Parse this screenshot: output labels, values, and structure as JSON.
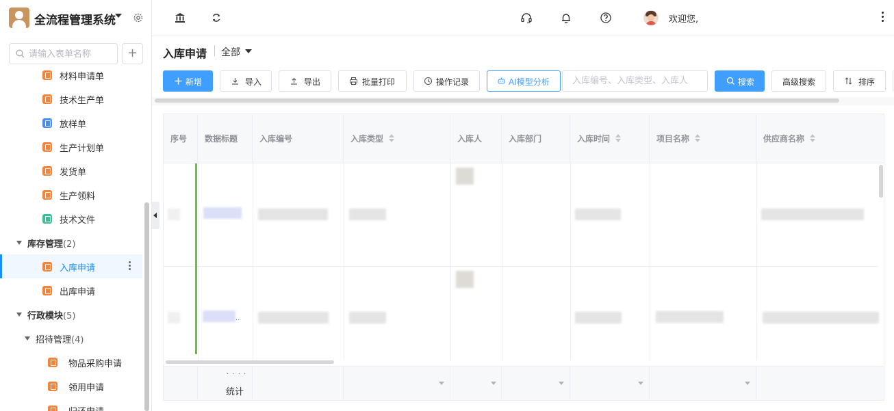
{
  "app": {
    "title": "全流程管理系统"
  },
  "sidebar": {
    "search_placeholder": "请输入表单名称",
    "items": [
      {
        "label": "材料申请单",
        "icon": "form-icon",
        "color": "#f5843a"
      },
      {
        "label": "技术生产单",
        "icon": "form-icon",
        "color": "#f5843a"
      },
      {
        "label": "放样单",
        "icon": "form-icon",
        "color": "#4a8ef5"
      },
      {
        "label": "生产计划单",
        "icon": "form-icon",
        "color": "#f5843a"
      },
      {
        "label": "发货单",
        "icon": "form-icon",
        "color": "#f5843a"
      },
      {
        "label": "生产领料",
        "icon": "form-icon",
        "color": "#f5843a"
      },
      {
        "label": "技术文件",
        "icon": "form-icon",
        "color": "#3dbf9c"
      }
    ],
    "group_inventory": {
      "label": "库存管理",
      "count": "(2)"
    },
    "inventory_items": [
      {
        "label": "入库申请",
        "active": true
      },
      {
        "label": "出库申请"
      }
    ],
    "group_admin": {
      "label": "行政模块",
      "count": "(5)"
    },
    "subgroup_reception": {
      "label": "招待管理",
      "count": "(4)"
    },
    "reception_items": [
      {
        "label": "物品采购申请"
      },
      {
        "label": "领用申请"
      },
      {
        "label": "归还申请"
      }
    ]
  },
  "header": {
    "welcome": "欢迎您,"
  },
  "page": {
    "title": "入库申请",
    "scope": "全部"
  },
  "toolbar": {
    "new_label": "新增",
    "import_label": "导入",
    "export_label": "导出",
    "batch_print_label": "批量打印",
    "log_label": "操作记录",
    "ai_label": "AI模型分析",
    "keyword_placeholder": "入库编号、入库类型、入库人",
    "search_label": "搜索",
    "advanced_label": "高级搜索",
    "sort_label": "排序"
  },
  "table": {
    "columns": [
      "序号",
      "数据标题",
      "入库编号",
      "入库类型",
      "入库人",
      "入库部门",
      "入库时间",
      "项目名称",
      "供应商名称"
    ],
    "footer_label": "统计",
    "footer_dots": "· · · ·",
    "cell_ellipsis": ".."
  }
}
